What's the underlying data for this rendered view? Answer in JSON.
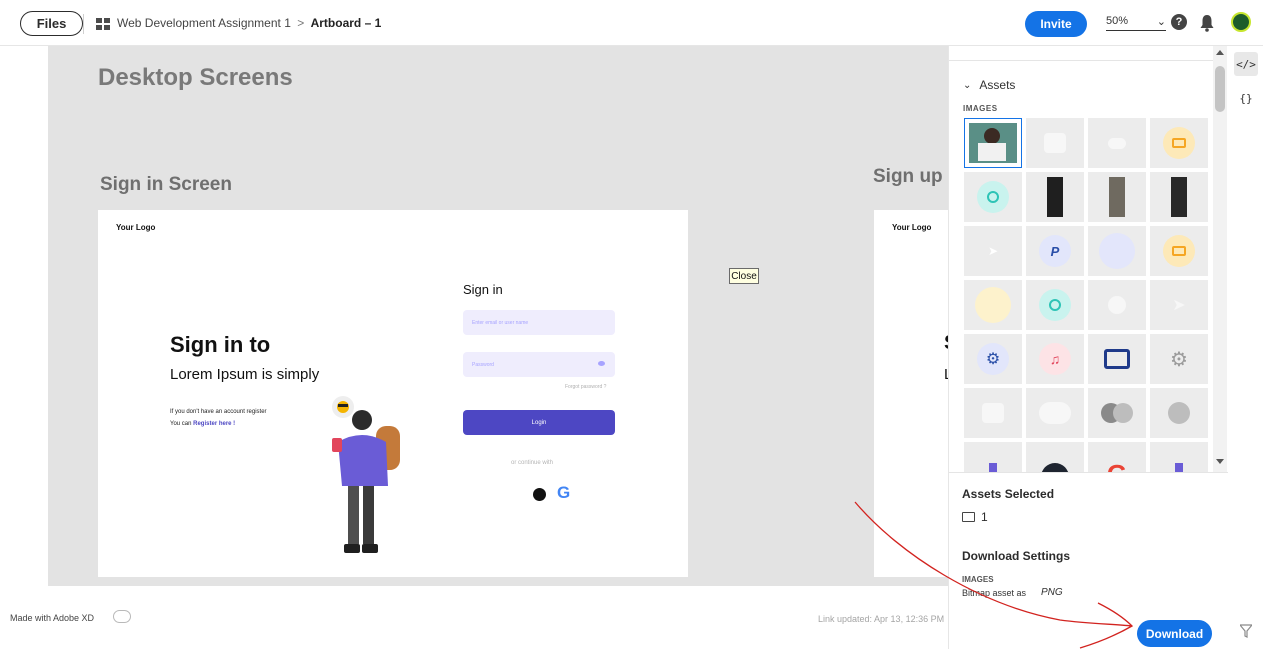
{
  "topbar": {
    "files_label": "Files",
    "project": "Web Development Assignment 1",
    "separator": ">",
    "artboard": "Artboard – 1",
    "invite_label": "Invite",
    "zoom": "50%",
    "zoom_caret": "⌄",
    "help_glyph": "?"
  },
  "canvas": {
    "section_title": "Desktop Screens",
    "screen1_title": "Sign in Screen",
    "screen2_title": "Sign up",
    "artboard1": {
      "logo": "Your Logo",
      "hero_line1": "Sign in to",
      "hero_line2": "Lorem Ipsum is simply",
      "note_line1": "If you don't have an account register",
      "note_line2_prefix": "You can",
      "note_link": "Register here !",
      "signin_heading": "Sign in",
      "email_placeholder": "Enter email or user name",
      "password_placeholder": "Password",
      "forgot": "Forgot password ?",
      "login_label": "Login",
      "continue_with": "or continue with",
      "google_letter": "G"
    },
    "artboard2": {
      "logo": "Your Logo",
      "hero_line1_char": "S",
      "hero_line2_char": "L"
    }
  },
  "tooltip": "Close",
  "footer": {
    "made_with": "Made with Adobe XD",
    "link_updated": "Link updated: Apr 13, 12:36 PM"
  },
  "panel": {
    "assets_header": "Assets",
    "chevron": "⌄",
    "images_label": "IMAGES",
    "assets_selected_title": "Assets Selected",
    "selected_count": "1",
    "download_settings_title": "Download Settings",
    "ds_images_label": "IMAGES",
    "bitmap_label": "Bitmap asset as",
    "format": "PNG",
    "download_label": "Download"
  },
  "rail": {
    "code_glyph": "</>",
    "brace_glyph": "{}"
  },
  "colors": {
    "accent": "#1473e6",
    "login_button": "#4d47c3",
    "field_bg": "#efedfd",
    "annotation": "#d2231f"
  }
}
